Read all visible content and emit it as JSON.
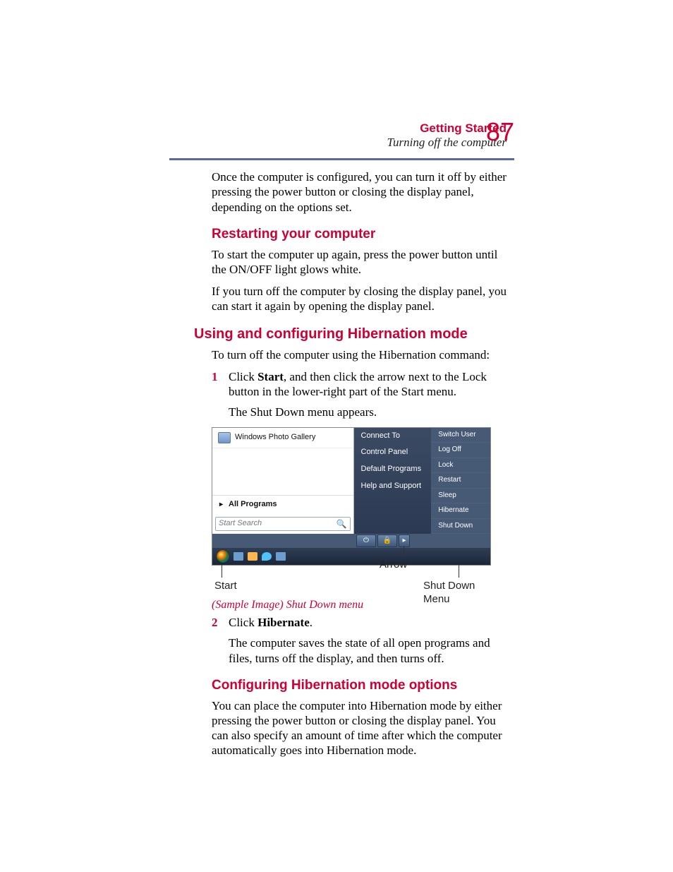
{
  "header": {
    "chapter": "Getting Started",
    "subtitle": "Turning off the computer",
    "page_number": "87"
  },
  "intro_para": "Once the computer is configured, you can turn it off by either pressing the power button or closing the display panel, depending on the options set.",
  "restart": {
    "heading": "Restarting your computer",
    "p1": "To start the computer up again, press the power button until the ON/OFF light glows white.",
    "p2": "If you turn off the computer by closing the display panel, you can start it again by opening the display panel."
  },
  "hiber": {
    "heading": "Using and configuring Hibernation mode",
    "lead": "To turn off the computer using the Hibernation command:",
    "step1_num": "1",
    "step1_pre": "Click ",
    "step1_bold": "Start",
    "step1_post": ", and then click the arrow next to the Lock button in the lower-right part of the Start menu.",
    "step1_sub": "The Shut Down menu appears.",
    "step2_num": "2",
    "step2_pre": "Click ",
    "step2_bold": "Hibernate",
    "step2_post": ".",
    "step2_sub": "The computer saves the state of all open programs and files, turns off the display, and then turns off."
  },
  "figure": {
    "program_item": "Windows Photo Gallery",
    "all_programs": "All Programs",
    "search_placeholder": "Start Search",
    "right_items": [
      "Connect To",
      "Control Panel",
      "Default Programs",
      "Help and Support"
    ],
    "power_items": [
      "Switch User",
      "Log Off",
      "Lock",
      "Restart",
      "Sleep",
      "Hibernate",
      "Shut Down"
    ],
    "power_icon": "⏻",
    "lock_icon": "🔒",
    "arrow_icon": "▸",
    "ann_start": "Start",
    "ann_arrow": "Arrow",
    "ann_shutdown": "Shut Down Menu",
    "caption": "(Sample Image) Shut Down menu"
  },
  "config": {
    "heading": "Configuring Hibernation mode options",
    "p1": "You can place the computer into Hibernation mode by either pressing the power button or closing the display panel. You can also specify an amount of time after which the computer automatically goes into Hibernation mode."
  }
}
